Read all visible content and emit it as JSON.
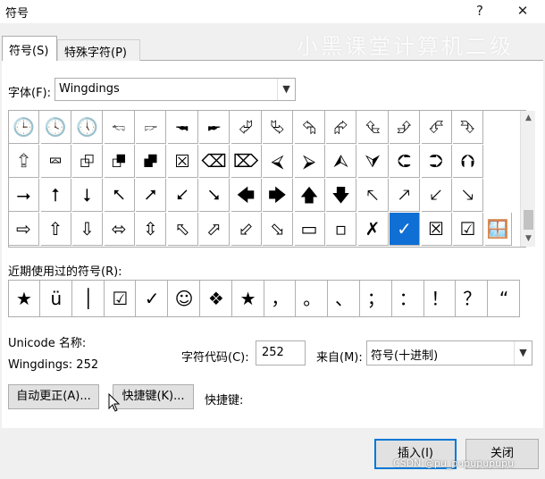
{
  "window": {
    "title": "符号",
    "help_glyph": "?",
    "close_glyph": "✕"
  },
  "tabs": [
    {
      "label": "符号(S)",
      "active": true
    },
    {
      "label": "特殊字符(P)",
      "active": false
    }
  ],
  "watermark": "小黑课堂计算机二级",
  "font": {
    "label": "字体(F):",
    "value": "Wingdings"
  },
  "symbol_grid": {
    "rows": [
      [
        "🕒",
        "🕓",
        "🕔",
        "🖘",
        "🖙",
        "🖚",
        "🖛",
        "⮰",
        "⮱",
        "⮲",
        "⮳",
        "⮴",
        "⮵",
        "⮶",
        "⮷"
      ],
      [
        "⮸",
        "⮹",
        "⮺",
        "⮻",
        "⮼",
        "⮽",
        "⌫",
        "⌦",
        "⮘",
        "⮚",
        "⮙",
        "⮛",
        "⮈",
        "⮊",
        "⮉"
      ],
      [
        "⭢",
        "⭡",
        "⭣",
        "⭦",
        "⭧",
        "⭩",
        "⭨",
        "🡄",
        "🡆",
        "🡅",
        "🡇",
        "🡔",
        "🡕",
        "🡗",
        "🡖"
      ],
      [
        "⇨",
        "⇧",
        "⇩",
        "⬄",
        "⇳",
        "⬁",
        "⬀",
        "⬃",
        "⬂",
        "▭",
        "▫",
        "✗",
        "✓",
        "☒",
        "☑"
      ]
    ],
    "extra_cells": [
      "🪟"
    ],
    "selected": "✓",
    "selection_color": "#0f6fd5"
  },
  "recent": {
    "label": "近期使用过的符号(R):",
    "symbols": [
      "★",
      "ü",
      "│",
      "☑",
      "✓",
      "☺",
      "❖",
      "★",
      "，",
      "。",
      "、",
      "；",
      "：",
      "！",
      "？",
      "“"
    ]
  },
  "unicode_name": {
    "label": "Unicode 名称:",
    "value": "Wingdings: 252"
  },
  "char_code": {
    "label": "字符代码(C):",
    "value": "252"
  },
  "from": {
    "label": "来自(M):",
    "value": "符号(十进制)"
  },
  "buttons": {
    "autocorrect": "自动更正(A)...",
    "shortcut_key": "快捷键(K)...",
    "shortcut_label": "快捷键:",
    "insert": "插入(I)",
    "close": "关闭"
  },
  "credit": "CSDN @pu_pupupupupu"
}
